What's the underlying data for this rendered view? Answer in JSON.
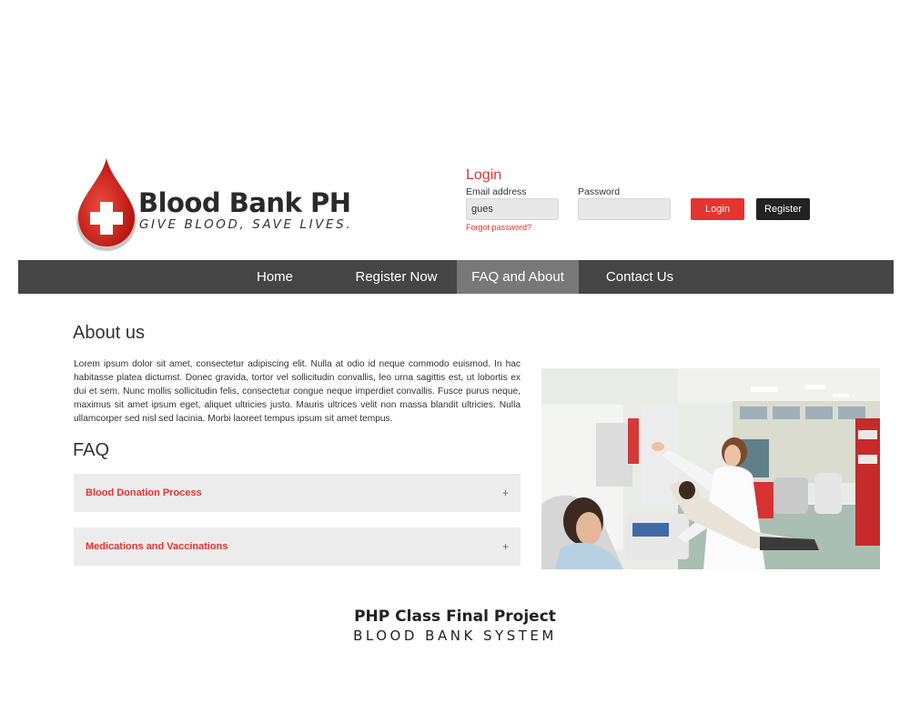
{
  "brand": {
    "title": "Blood Bank PH",
    "tagline": "GIVE BLOOD, SAVE LIVES.",
    "logo_icon": "blood-drop-cross-icon",
    "accent_color": "#e3342f"
  },
  "login": {
    "title": "Login",
    "email_label": "Email address",
    "email_value": "gues",
    "password_label": "Password",
    "password_value": "",
    "forgot_label": "Forgot password?",
    "login_button": "Login",
    "register_button": "Register"
  },
  "nav": {
    "items": [
      {
        "label": "Home",
        "active": false
      },
      {
        "label": "Register Now",
        "active": false
      },
      {
        "label": "FAQ and About",
        "active": true
      },
      {
        "label": "Contact Us",
        "active": false
      }
    ]
  },
  "about": {
    "heading": "About us",
    "text": "Lorem ipsum dolor sit amet, consectetur adipiscing elit. Nulla at odio id neque commodo euismod. In hac habitasse platea dictumst. Donec gravida, tortor vel sollicitudin convallis, leo urna sagittis est, ut lobortis ex dui et sem. Nunc mollis sollicitudin felis, consectetur congue neque imperdiet convallis. Fusce purus neque, maximus sit amet ipsum eget, aliquet ultricies justo. Mauris ultrices velit non massa blandit ultricies. Nulla ullamcorper sed nisl sed lacinia. Morbi laoreet tempus ipsum sit amet tempus."
  },
  "faq": {
    "heading": "FAQ",
    "items": [
      {
        "label": "Blood Donation Process",
        "toggle": "+"
      },
      {
        "label": "Medications and Vaccinations",
        "toggle": "+"
      }
    ]
  },
  "caption": {
    "title": "PHP Class Final Project",
    "subtitle": "BLOOD BANK SYSTEM"
  }
}
